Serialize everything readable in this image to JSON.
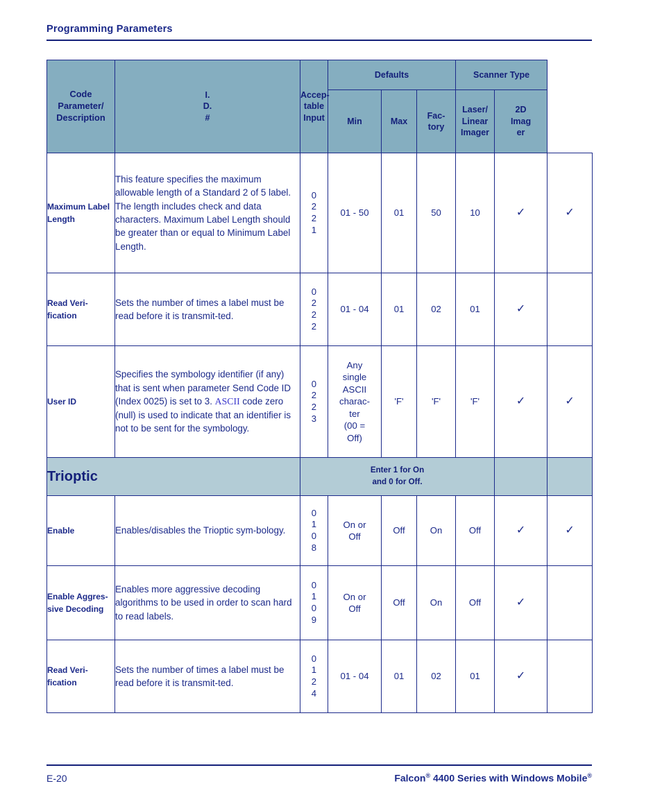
{
  "header": {
    "title": "Programming Parameters"
  },
  "table": {
    "columns": {
      "code_parameter": "Code Parameter/ Description",
      "id_number": [
        "I.",
        "D.",
        "#"
      ],
      "acceptable_input": [
        "Accep-",
        "table",
        "Input"
      ],
      "defaults_group": "Defaults",
      "scanner_type_group": "Scanner Type",
      "min": "Min",
      "max": "Max",
      "factory": [
        "Fac-",
        "tory"
      ],
      "laser_linear_imager": [
        "Laser/",
        "Linear",
        "Imager"
      ],
      "two_d_imager": [
        "2D",
        "Imag",
        "er"
      ]
    },
    "rows": [
      {
        "name": "Maximum Label Length",
        "description_pre": "This feature specifies the maximum allowable length of a Standard 2 of 5 label. The length includes check and data characters. Maximum Label Length should be greater than or equal to Minimum Label Length.",
        "id": [
          "0",
          "2",
          "2",
          "1"
        ],
        "acceptable_input": "01 - 50",
        "min": "01",
        "max": "50",
        "factory": "10",
        "laser_linear_imager": true,
        "two_d_imager": true
      },
      {
        "name": "Read Veri-fication",
        "description_pre": "Sets the number of times a label must be read before it is transmit-ted.",
        "id": [
          "0",
          "2",
          "2",
          "2"
        ],
        "acceptable_input": "01 - 04",
        "min": "01",
        "max": "02",
        "factory": "01",
        "laser_linear_imager": true,
        "two_d_imager": false
      },
      {
        "name": "User ID",
        "description_part1": "Specifies the symbology identifier (if any) that is sent when parameter Send Code ID (Index 0025) is set to 3. ",
        "description_link": "ASCII",
        "description_part2": " code zero (null) is used to indicate that an identifier is not to be sent for the symbology.",
        "id": [
          "0",
          "2",
          "2",
          "3"
        ],
        "acceptable_input": [
          "Any",
          "single",
          "ASCII",
          "charac-",
          "ter",
          "(00 =",
          "Off)"
        ],
        "min": "'F'",
        "max": "'F'",
        "factory": "'F'",
        "laser_linear_imager": true,
        "two_d_imager": true
      }
    ],
    "section": {
      "title": "Trioptic",
      "note": [
        "Enter 1 for On",
        "and 0 for Off."
      ]
    },
    "section_rows": [
      {
        "name": "Enable",
        "description_pre": "Enables/disables the Trioptic sym-bology.",
        "id": [
          "0",
          "1",
          "0",
          "8"
        ],
        "acceptable_input": [
          "On or",
          "Off"
        ],
        "min": "Off",
        "max": "On",
        "factory": "Off",
        "laser_linear_imager": true,
        "two_d_imager": true
      },
      {
        "name": "Enable Aggres-sive Decoding",
        "description_pre": "Enables more aggressive decoding algorithms to be used in order to scan hard to read labels.",
        "id": [
          "0",
          "1",
          "0",
          "9"
        ],
        "acceptable_input": [
          "On or",
          "Off"
        ],
        "min": "Off",
        "max": "On",
        "factory": "Off",
        "laser_linear_imager": true,
        "two_d_imager": false
      },
      {
        "name": "Read Veri-fication",
        "description_pre": "Sets the number of times a label must be read before it is transmit-ted.",
        "id": [
          "0",
          "1",
          "2",
          "4"
        ],
        "acceptable_input": "01 - 04",
        "min": "01",
        "max": "02",
        "factory": "01",
        "laser_linear_imager": true,
        "two_d_imager": false
      }
    ],
    "checkmark_glyph": "✓"
  },
  "footer": {
    "page_number": "E-20",
    "doc_title_part1": "Falcon",
    "doc_title_reg1": "®",
    "doc_title_part2": " 4400 Series with Windows Mobile",
    "doc_title_reg2": "®"
  },
  "colors": {
    "header_band": "#85aec0",
    "section_band": "#b3ccd6",
    "text": "#1c2a8a",
    "link": "#3a36cc"
  }
}
